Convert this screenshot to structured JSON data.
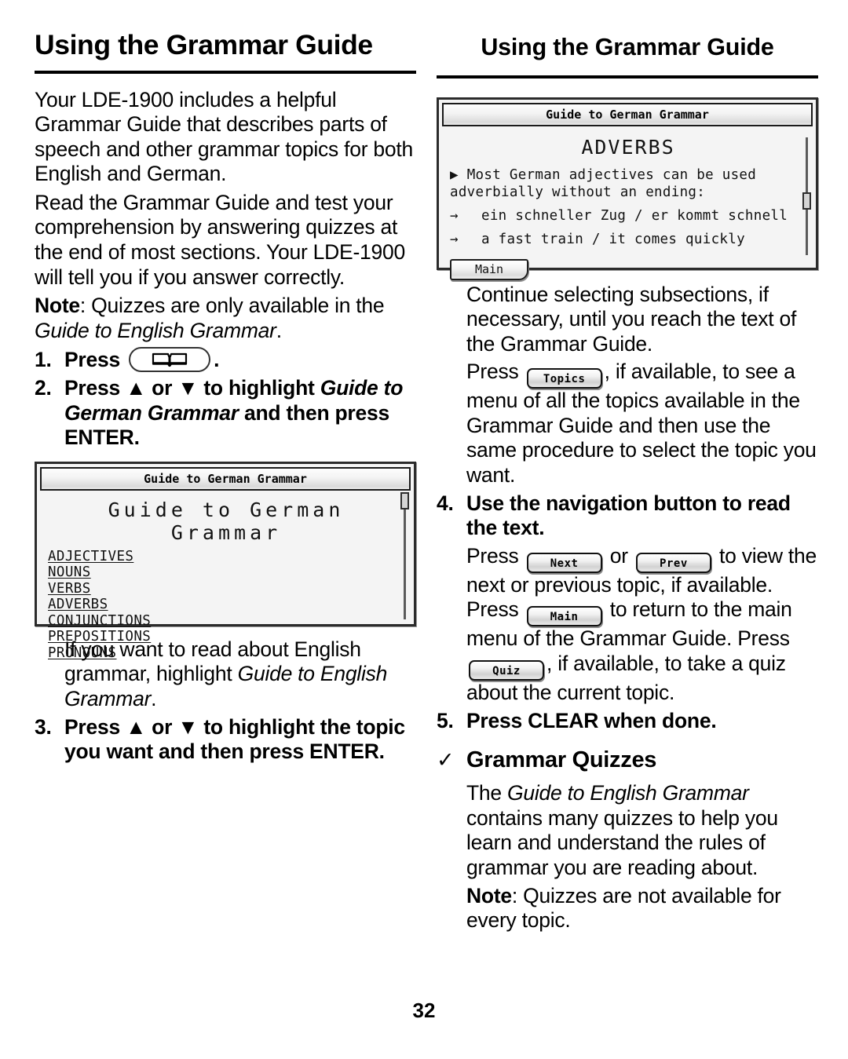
{
  "page": {
    "number": "32"
  },
  "left_column": {
    "heading": "Using the Grammar Guide",
    "paragraphs": {
      "intro": "Your LDE-1900 includes a helpful Grammar Guide that describes parts of speech and other grammar topics for both English and German.",
      "read": "Read the Grammar Guide and test your comprehension by answering quizzes at the end of most sections. Your LDE-1900 will tell you if you answer correctly."
    },
    "note": {
      "label": "Note",
      "separator": ": ",
      "text_before": "Quizzes are only available in the ",
      "italic": "Guide to English Grammar",
      "text_after": "."
    },
    "step1": {
      "number": "1.",
      "text_before": "Press ",
      "key": "book-key",
      "text_after": "."
    },
    "step2": {
      "number": "2.",
      "text_before": "Press ▲ or ▼ to highlight ",
      "italic": "Guide to German Grammar",
      "text_after": " and then press ENTER."
    },
    "lcd": {
      "titlebar": "Guide to German Grammar",
      "screen_title": "Guide to German Grammar",
      "menu_items": [
        "ADJECTIVES",
        "NOUNS",
        "VERBS",
        "ADVERBS",
        "CONJUNCTIONS",
        "PREPOSITIONS",
        "PRONOUNS"
      ]
    },
    "english_note": {
      "text_before": "If you want to read about English grammar, highlight ",
      "italic": "Guide to English Grammar",
      "text_after": "."
    },
    "step3": {
      "number": "3.",
      "text": "Press ▲ or ▼ to highlight the topic you want and then press ENTER."
    }
  },
  "right_column": {
    "heading": "Using the Grammar Guide",
    "lcd": {
      "titlebar": "Guide to German Grammar",
      "screen_heading": "ADVERBS",
      "bullet_glyph": "▶",
      "bullet_text": "Most German adjectives can be used adverbially without an ending:",
      "arrow_glyph": "→",
      "example_german": "ein schneller Zug / er kommt schnell",
      "example_english": "a fast train / it comes quickly",
      "button_label": "Main"
    },
    "continue_paragraph": "Continue selecting subsections, if necessary, until you reach the text of the Grammar Guide.",
    "topics_paragraph": {
      "text_before": "Press ",
      "key": "Topics",
      "text_after": ", if available, to see a menu of all the topics available in the Grammar Guide and then use the same procedure to select the topic you want."
    },
    "step4": {
      "number": "4.",
      "text": "Use the navigation button to read the text."
    },
    "nav_paragraph": {
      "p1": "Press ",
      "key_next": "Next",
      "p2": " or ",
      "key_prev": "Prev",
      "p3": " to view the next or previous topic, if available. Press ",
      "key_main": "Main",
      "p4": " to return to the main menu of the Grammar Guide. Press ",
      "key_quiz": "Quiz",
      "p5": ", if available, to take a quiz about the current topic."
    },
    "step5": {
      "number": "5.",
      "text": "Press CLEAR when done."
    },
    "section_heading": {
      "check": "✓",
      "title": "Grammar Quizzes"
    },
    "quizzes_paragraph": {
      "text_before": "The ",
      "italic": "Guide to English Grammar",
      "text_after": " contains many quizzes to help you learn and understand the rules of grammar you are reading about."
    },
    "note": {
      "label": "Note",
      "separator": ": ",
      "text": "Quizzes are not available for every topic."
    }
  }
}
